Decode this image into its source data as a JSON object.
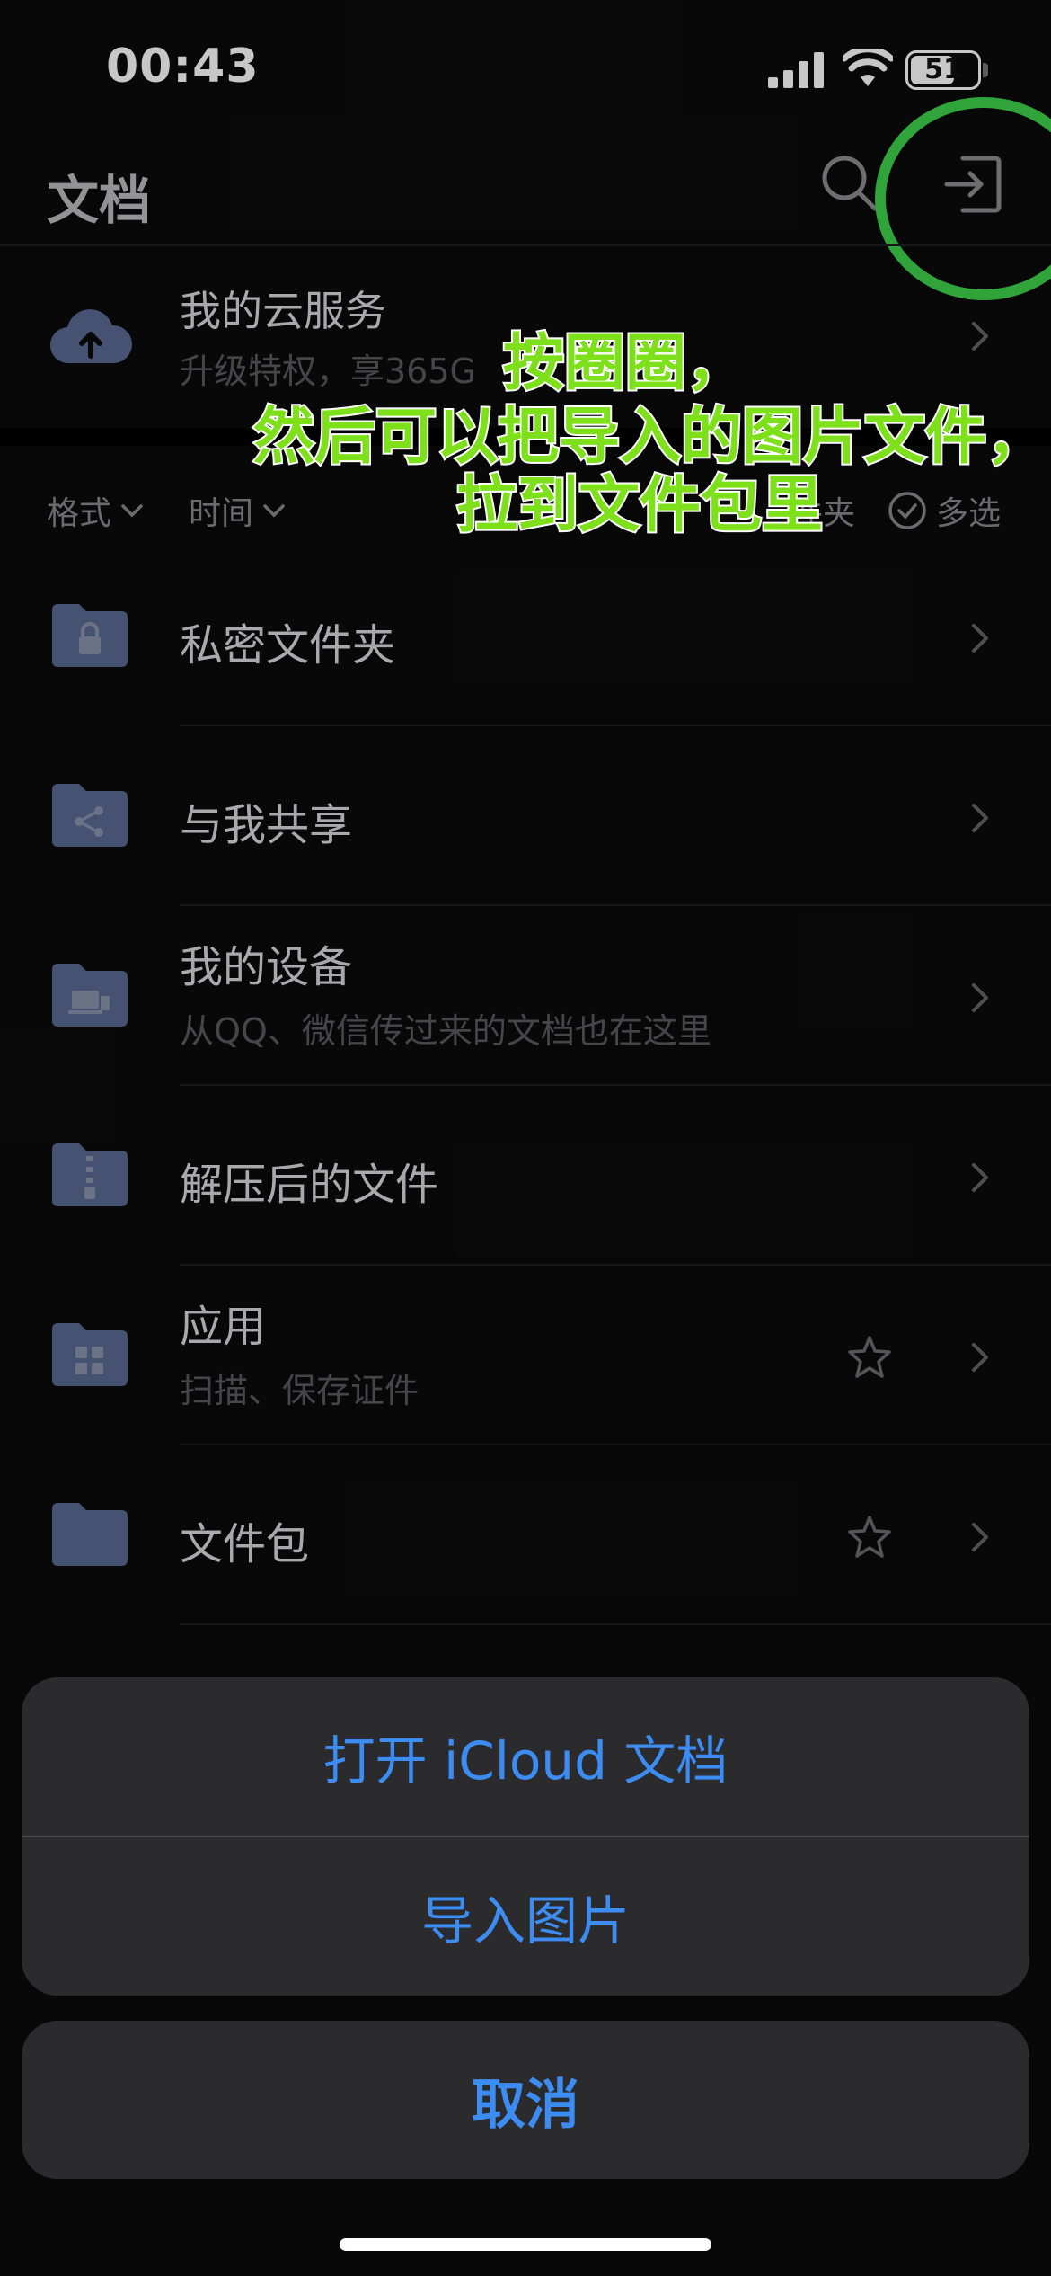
{
  "status_bar": {
    "time": "00:43",
    "battery": "51"
  },
  "header": {
    "title": "文档",
    "search_icon": "search-icon",
    "import_icon": "import-icon"
  },
  "cloud": {
    "title": "我的云服务",
    "subtitle": "升级特权，享365G"
  },
  "filters": {
    "format": "格式",
    "time": "时间",
    "folder": "件夹",
    "multiselect": "多选"
  },
  "rows": [
    {
      "label": "私密文件夹",
      "sub": ""
    },
    {
      "label": "与我共享",
      "sub": ""
    },
    {
      "label": "我的设备",
      "sub": "从QQ、微信传过来的文档也在这里"
    },
    {
      "label": "解压后的文件",
      "sub": ""
    },
    {
      "label": "应用",
      "sub": "扫描、保存证件"
    },
    {
      "label": "文件包",
      "sub": ""
    }
  ],
  "annotation": {
    "line1": "按圈圈，",
    "line2": "然后可以把导入的图片文件，",
    "line3": "拉到文件包里"
  },
  "action_sheet": {
    "open_icloud": "打开 iCloud 文档",
    "import_images": "导入图片",
    "cancel": "取消"
  },
  "colors": {
    "accent": "#3d8cf2",
    "highlight": "#3ed14c",
    "annotation": "#7ee01a",
    "folder": "#5a6a92"
  }
}
